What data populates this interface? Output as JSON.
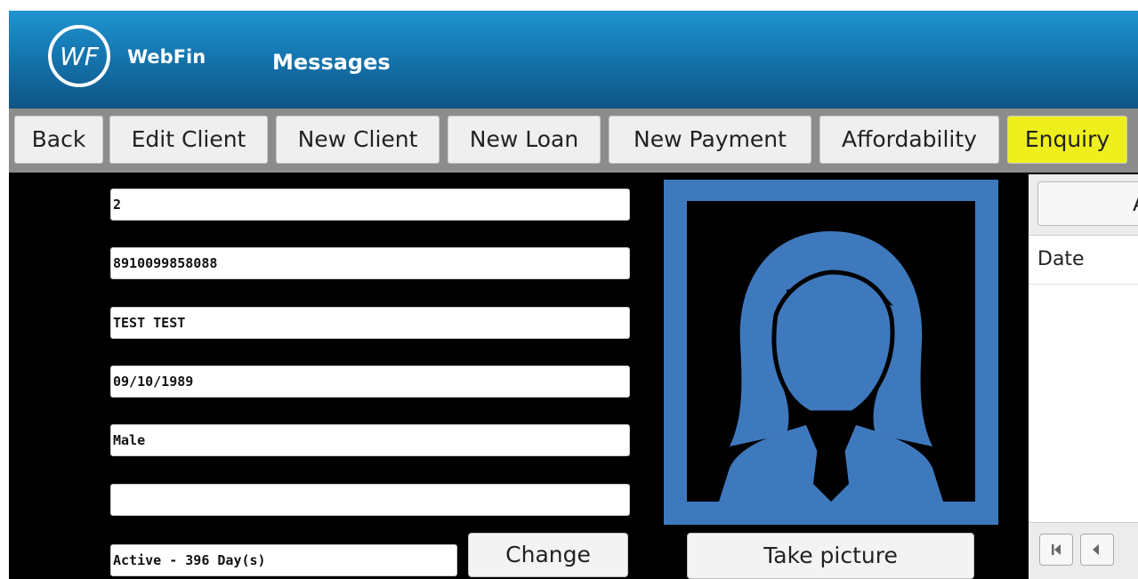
{
  "header": {
    "logo_text": "WF",
    "brand": "WebFin",
    "title": "Messages"
  },
  "toolbar": {
    "buttons": [
      "Back",
      "Edit Client",
      "New Client",
      "New Loan",
      "New Payment",
      "Affordability",
      "Enquiry"
    ],
    "highlighted": "Enquiry",
    "highlight_color": "#efef1e"
  },
  "client": {
    "fields": [
      "2",
      "8910099858088",
      "TEST TEST",
      "09/10/1989",
      "Male",
      ""
    ],
    "status": "Active - 396 Day(s)",
    "change_label": "Change"
  },
  "photo": {
    "placeholder_icon": "female-avatar-icon",
    "frame_color": "#3f79bd",
    "take_picture_label": "Take picture"
  },
  "side_panel": {
    "top_button_label": "A",
    "column_header": "Date",
    "pager_icons": [
      "first-page-icon",
      "prev-page-icon"
    ]
  },
  "colors": {
    "header_blue": "#1576b0",
    "toolbar_grey": "#8c8c8c",
    "background": "#000000"
  }
}
